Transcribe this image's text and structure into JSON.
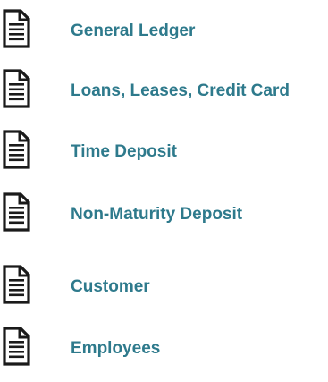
{
  "documents": {
    "items": [
      {
        "label": "General Ledger",
        "icon": "document-icon"
      },
      {
        "label": "Loans, Leases, Credit Card",
        "icon": "document-icon"
      },
      {
        "label": "Time Deposit",
        "icon": "document-icon"
      },
      {
        "label": "Non-Maturity Deposit",
        "icon": "document-icon"
      },
      {
        "label": "Customer",
        "icon": "document-icon"
      },
      {
        "label": "Employees",
        "icon": "document-icon"
      }
    ]
  },
  "colors": {
    "link_text": "#2e7a8c",
    "icon": "#1a1a1a",
    "background": "#ffffff"
  }
}
